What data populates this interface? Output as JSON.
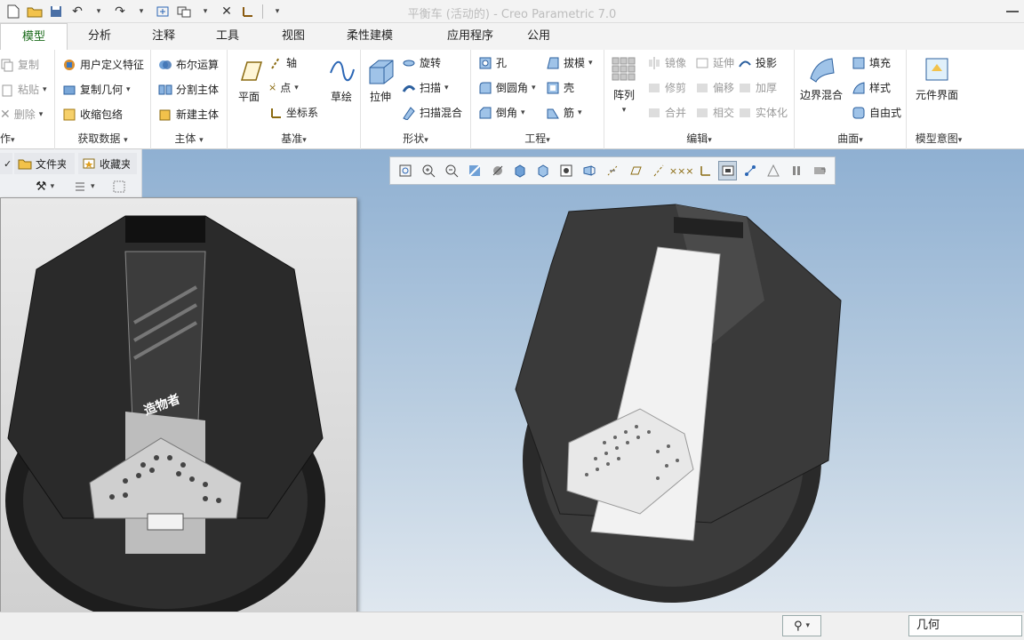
{
  "window": {
    "title": "平衡车 (活动的) - Creo Parametric 7.0"
  },
  "tabs": [
    "模型",
    "分析",
    "注释",
    "工具",
    "视图",
    "柔性建模",
    "应用程序",
    "公用"
  ],
  "active_tab": "模型",
  "ribbon": {
    "ops": {
      "copy": "复制",
      "paste": "粘贴",
      "delete": "删除",
      "group_label": "作"
    },
    "get_data": {
      "udf": "用户定义特征",
      "copy_geom": "复制几何",
      "shrinkwrap": "收缩包络",
      "group_label": "获取数据"
    },
    "body": {
      "boolean": "布尔运算",
      "split": "分割主体",
      "new_body": "新建主体",
      "group_label": "主体"
    },
    "datum": {
      "plane": "平面",
      "axis": "轴",
      "point": "点",
      "csys": "坐标系",
      "sketch": "草绘",
      "group_label": "基准"
    },
    "shapes": {
      "extrude": "拉伸",
      "revolve": "旋转",
      "sweep": "扫描",
      "swept_blend": "扫描混合",
      "group_label": "形状"
    },
    "engineering": {
      "hole": "孔",
      "round": "倒圆角",
      "chamfer": "倒角",
      "draft": "拔模",
      "shell": "壳",
      "rib": "筋",
      "group_label": "工程"
    },
    "editing": {
      "pattern": "阵列",
      "mirror": "镜像",
      "trim": "修剪",
      "merge": "合并",
      "extend": "延伸",
      "offset": "偏移",
      "intersect": "相交",
      "project": "投影",
      "thicken": "加厚",
      "solidify": "实体化",
      "group_label": "编辑"
    },
    "surfaces": {
      "boundary_blend": "边界混合",
      "fill": "填充",
      "style": "样式",
      "freestyle": "自由式",
      "group_label": "曲面"
    },
    "model_intent": {
      "component_interface": "元件界面",
      "group_label": "模型意图"
    }
  },
  "panel": {
    "tab_files": "文件夹",
    "tab_favorites": "收藏夹"
  },
  "photo": {
    "brand_text": "造物者"
  },
  "status": {
    "filter_value": "几何"
  }
}
